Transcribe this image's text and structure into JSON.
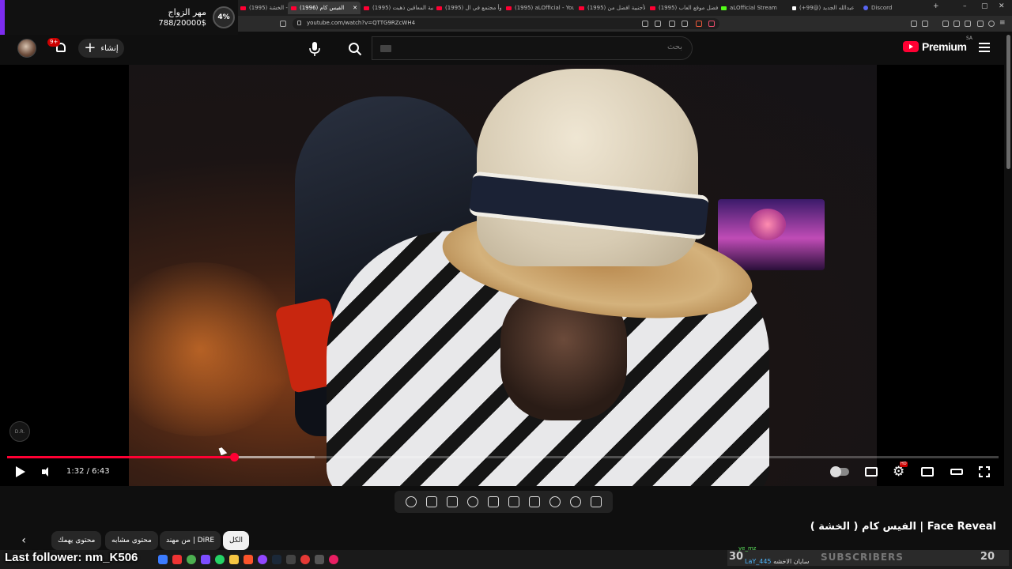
{
  "browser": {
    "tabs": [
      {
        "title": "(1995) الخشة - YouTube"
      },
      {
        "title": "(1996) الفيس كام",
        "active": true
      },
      {
        "title": "(1995) لعبة المعاقين ذهبت"
      },
      {
        "title": "(1995) أسوأ مجتمع في ال"
      },
      {
        "title": "(1995) aLOfficial - YouTube"
      },
      {
        "title": "(1995) الأجنبية افضل من"
      },
      {
        "title": "(1995) افضل موقع العاب"
      },
      {
        "title": "aLOfficial Stream"
      },
      {
        "title": "عبدالله الجديد (@99+)"
      },
      {
        "title": "Discord"
      }
    ],
    "url": "youtube.com/watch?v=QTTG9RZcWH4"
  },
  "goal_overlay": {
    "title": "مهر الزواج",
    "value": "788/20000$",
    "percent": "4%"
  },
  "masthead": {
    "notifications_badge": "9+",
    "create_label": "إنشاء",
    "search_placeholder": "بحث",
    "logo_text": "Premium",
    "country_code": "SA"
  },
  "player": {
    "time": "1:32 / 6:43",
    "progress_fraction": 0.229,
    "buffered_fraction": 0.31,
    "hd_badge": "HD",
    "watermark": "D.R."
  },
  "video": {
    "title": "الفيس كام ( الخشة ) | Face Reveal"
  },
  "chips": [
    {
      "label": "الكل",
      "selected": true
    },
    {
      "label": "من مهند | DiRE"
    },
    {
      "label": "محتوى مشابه"
    },
    {
      "label": "محتوى يهمك"
    }
  ],
  "stream_overlay": {
    "last_follower": "Last follower: nm_K506",
    "subscribers_label": "SUBSCRIBERS",
    "subscribers_count": "20",
    "subscribers_left": "30",
    "chat_user": "LaY_445",
    "chat_text": "سايان الاخشه",
    "chat_top": "ye_mz"
  },
  "colors": {
    "youtube_red": "#ff0033",
    "goal_accent": "#7d2cf0",
    "background": "#0f0f0f"
  }
}
